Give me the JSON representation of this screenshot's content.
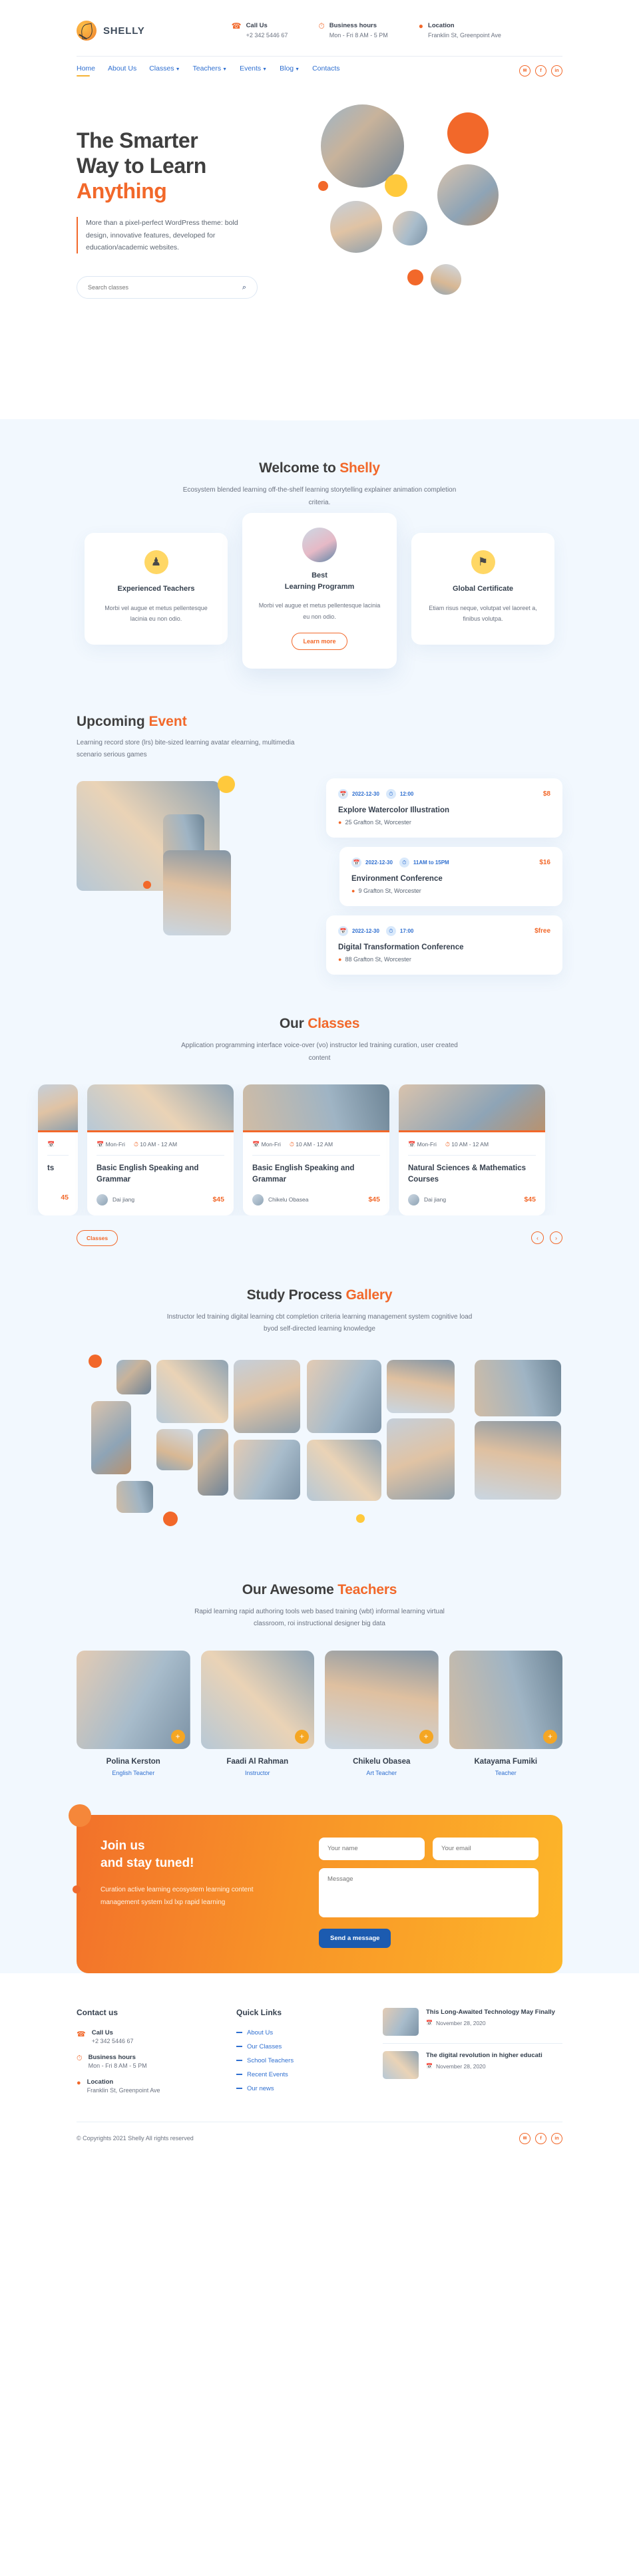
{
  "brand": {
    "name": "SHELLY",
    "logo_icon": "leaf-icon"
  },
  "topbar": {
    "contacts": [
      {
        "icon": "phone-icon",
        "label": "Call Us",
        "value": "+2 342 5446 67"
      },
      {
        "icon": "clock-icon",
        "label": "Business hours",
        "value": "Mon - Fri 8 AM - 5 PM"
      },
      {
        "icon": "location-pin-icon",
        "label": "Location",
        "value": "Franklin St, Greenpoint Ave"
      }
    ]
  },
  "nav": {
    "items": [
      {
        "label": "Home",
        "has_dropdown": false,
        "active": true
      },
      {
        "label": "About Us",
        "has_dropdown": false,
        "active": false
      },
      {
        "label": "Classes",
        "has_dropdown": true,
        "active": false
      },
      {
        "label": "Teachers",
        "has_dropdown": true,
        "active": false
      },
      {
        "label": "Events",
        "has_dropdown": true,
        "active": false
      },
      {
        "label": "Blog",
        "has_dropdown": true,
        "active": false
      },
      {
        "label": "Contacts",
        "has_dropdown": false,
        "active": false
      }
    ],
    "socials": [
      {
        "name": "twitter-icon",
        "glyph": "✉"
      },
      {
        "name": "facebook-icon",
        "glyph": "f"
      },
      {
        "name": "linkedin-icon",
        "glyph": "in"
      }
    ]
  },
  "hero": {
    "title_line1": "The Smarter",
    "title_line2": "Way to Learn",
    "title_accent": "Anything",
    "description": "More than a pixel-perfect WordPress theme: bold design, innovative features, developed for education/academic websites.",
    "search_placeholder": "Search classes",
    "search_value": "",
    "search_icon": "search-icon"
  },
  "welcome": {
    "title_plain": "Welcome to ",
    "title_accent": "Shelly",
    "description": "Ecosystem blended learning off-the-shelf learning storytelling explainer animation completion criteria.",
    "cards": [
      {
        "icon": "graduate-teacher-icon",
        "glyph": "♟",
        "title": "Experienced Teachers",
        "text": "Morbi vel augue et metus pellentesque lacinia eu non odio."
      },
      {
        "icon": "student-photo",
        "title_line1": "Best",
        "title_line2": "Learning Programm",
        "text": "Morbi vel augue et metus pellentesque lacinia eu non odio.",
        "button": "Learn more"
      },
      {
        "icon": "certificate-icon",
        "glyph": "⚑",
        "title": "Global Certificate",
        "text": "Etiam risus neque, volutpat vel laoreet a, finibus volutpa."
      }
    ]
  },
  "events": {
    "title_plain": "Upcoming ",
    "title_accent": "Event",
    "description": "Learning record store (lrs) bite-sized learning avatar elearning, multimedia scenario serious games",
    "items": [
      {
        "date": "2022-12-30",
        "date_icon": "calendar-icon",
        "time": "12:00",
        "time_icon": "clock-icon",
        "price": "$8",
        "name": "Explore Watercolor Illustration",
        "location": "25 Grafton St, Worcester",
        "location_icon": "location-pin-icon"
      },
      {
        "date": "2022-12-30",
        "date_icon": "calendar-icon",
        "time": "11AM to 15PM",
        "time_icon": "clock-icon",
        "price": "$16",
        "name": "Environment Conference",
        "location": "9 Grafton St, Worcester",
        "location_icon": "location-pin-icon"
      },
      {
        "date": "2022-12-30",
        "date_icon": "calendar-icon",
        "time": "17:00",
        "time_icon": "clock-icon",
        "price": "$free",
        "name": "Digital Transformation Conference",
        "location": "88 Grafton St, Worcester",
        "location_icon": "location-pin-icon"
      }
    ]
  },
  "classes": {
    "title_plain": "Our ",
    "title_accent": "Classes",
    "description": "Application programming interface voice-over (vo) instructor led training curation, user created content",
    "cards": [
      {
        "days": "Mon-Fri",
        "hours": "10 AM - 12 AM",
        "title": "Basic English Speaking and Grammar",
        "author": "Dai jiang",
        "price": "$45"
      },
      {
        "days": "Mon-Fri",
        "hours": "10 AM - 12 AM",
        "title": "Basic English Speaking and Grammar",
        "author": "Chikelu Obasea",
        "price": "$45"
      },
      {
        "days": "Mon-Fri",
        "hours": "10 AM - 12 AM",
        "title": "Natural Sciences & Mathematics Courses",
        "author": "Dai jiang",
        "price": "$45"
      }
    ],
    "partial_card": {
      "title_fragment": "ts",
      "price": "45"
    },
    "filter_pill": "Classes",
    "prev_icon": "chevron-left-icon",
    "next_icon": "chevron-right-icon"
  },
  "gallery": {
    "title_plain": "Study Process ",
    "title_accent": "Gallery",
    "description": "Instructor led training digital learning cbt completion criteria learning management system cognitive load byod self-directed learning knowledge"
  },
  "teachers": {
    "title_plain": "Our Awesome ",
    "title_accent": "Teachers",
    "description": "Rapid learning rapid authoring tools web based training (wbt) informal learning virtual classroom, roi instructional designer big data",
    "items": [
      {
        "name": "Polina Kerston",
        "role": "English Teacher",
        "action_icon": "plus-icon",
        "action_glyph": "+"
      },
      {
        "name": "Faadi Al Rahman",
        "role": "Instructor",
        "action_icon": "plus-icon",
        "action_glyph": "+"
      },
      {
        "name": "Chikelu Obasea",
        "role": "Art Teacher",
        "action_icon": "plus-icon",
        "action_glyph": "+"
      },
      {
        "name": "Katayama Fumiki",
        "role": "Teacher",
        "action_icon": "plus-icon",
        "action_glyph": "+"
      }
    ]
  },
  "cta": {
    "title_line1": "Join us",
    "title_line2": "and stay tuned!",
    "text": "Curation active learning ecosystem learning content management system lxd lxp rapid learning",
    "name_placeholder": "Your name",
    "name_value": "",
    "email_placeholder": "Your email",
    "email_value": "",
    "message_placeholder": "Message",
    "message_value": "",
    "submit_label": "Send a message"
  },
  "footer": {
    "contact_heading": "Contact us",
    "contacts": [
      {
        "icon": "phone-icon",
        "label": "Call Us",
        "value": "+2 342 5446 67"
      },
      {
        "icon": "clock-icon",
        "label": "Business hours",
        "value": "Mon - Fri 8 AM - 5 PM"
      },
      {
        "icon": "location-pin-icon",
        "label": "Location",
        "value": "Franklin St, Greenpoint Ave"
      }
    ],
    "links_heading": "Quick Links",
    "links": [
      {
        "label": "About Us"
      },
      {
        "label": "Our Classes"
      },
      {
        "label": "School Teachers"
      },
      {
        "label": "Recent Events"
      },
      {
        "label": "Our news"
      }
    ],
    "posts": [
      {
        "title": "This Long-Awaited Technology May Finally",
        "date": "November 28, 2020",
        "date_icon": "calendar-icon"
      },
      {
        "title": "The digital revolution in higher educati",
        "date": "November 28, 2020",
        "date_icon": "calendar-icon"
      }
    ],
    "copyright": "© Copyrights 2021 Shelly All rights reserved",
    "socials": [
      {
        "name": "twitter-icon",
        "glyph": "✉"
      },
      {
        "name": "facebook-icon",
        "glyph": "f"
      },
      {
        "name": "linkedin-icon",
        "glyph": "in"
      }
    ]
  },
  "colors": {
    "accent_orange": "#f2682a",
    "accent_yellow": "#ffc93c",
    "link_blue": "#2f6fd0",
    "dark_text": "#3f3f3f",
    "section_bg": "#f2f8fe",
    "cta_blue": "#1c5bb0"
  }
}
